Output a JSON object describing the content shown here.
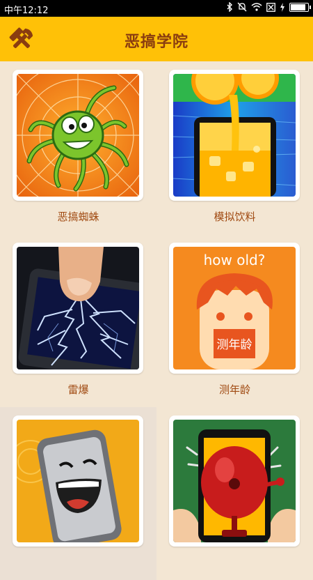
{
  "status_bar": {
    "time": "中午12:12",
    "icons": [
      "bluetooth-icon",
      "mute-icon",
      "wifi-icon",
      "sim-icon",
      "charging-icon",
      "battery-icon"
    ]
  },
  "app_bar": {
    "title": "恶搞学院",
    "tool_icon": "hammer-wrench-icon"
  },
  "apps": [
    {
      "label": "恶搞蜘蛛",
      "icon": "spider-icon"
    },
    {
      "label": "模拟饮料",
      "icon": "juice-phone-icon"
    },
    {
      "label": "雷爆",
      "icon": "lightning-phone-icon"
    },
    {
      "label": "测年龄",
      "icon": "age-test-icon",
      "overlay_top": "how old?",
      "overlay_badge": "测年龄"
    },
    {
      "label": "",
      "icon": "laughing-phone-icon"
    },
    {
      "label": "",
      "icon": "bell-phone-icon"
    }
  ],
  "colors": {
    "app_bar": "#ffc107",
    "title": "#8a3d10",
    "label": "#a04a12",
    "background": "#f3e6d3"
  }
}
